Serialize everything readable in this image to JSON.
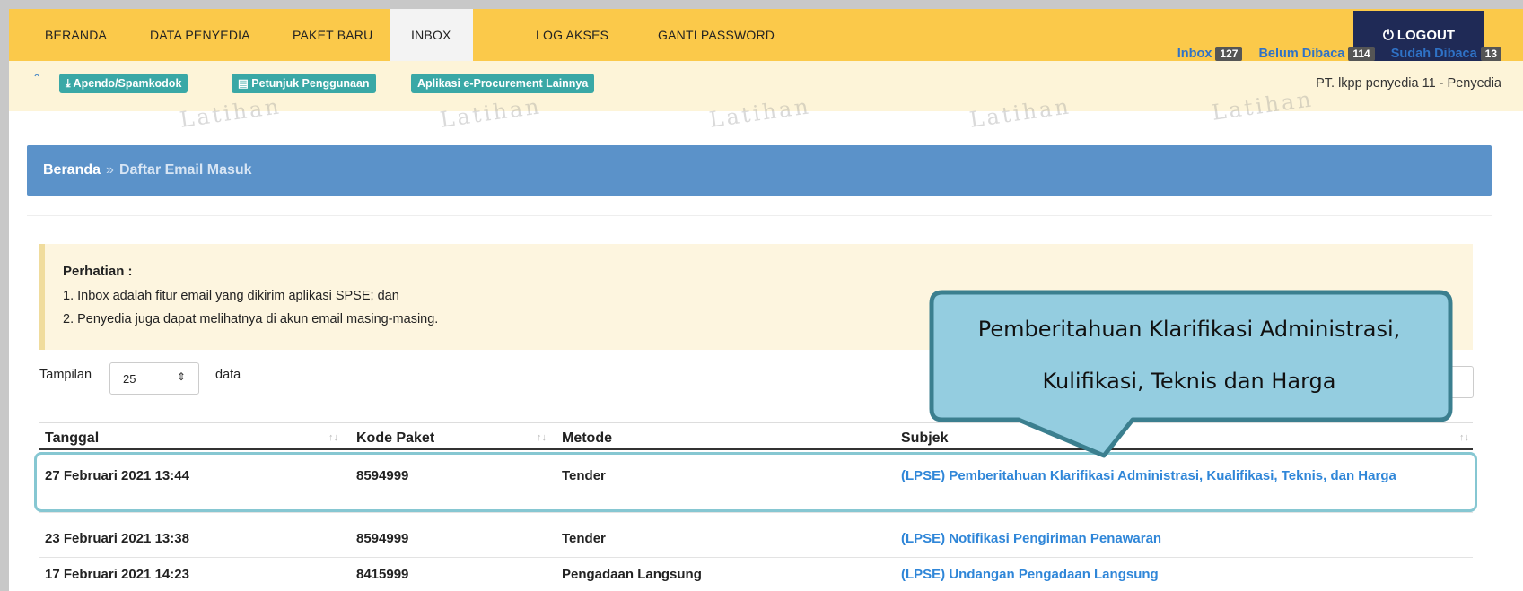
{
  "nav": {
    "items": [
      {
        "label": "BERANDA"
      },
      {
        "label": "DATA PENYEDIA"
      },
      {
        "label": "PAKET BARU"
      },
      {
        "label": "INBOX"
      },
      {
        "label": "LOG AKSES"
      },
      {
        "label": "GANTI PASSWORD"
      }
    ],
    "active": "INBOX",
    "logout_label": "LOGOUT",
    "logout_icon": "power-icon"
  },
  "subbar": {
    "links": [
      {
        "label": "Apendo/Spamkodok",
        "icon": "download-icon"
      },
      {
        "label": "Petunjuk Penggunaan",
        "icon": "book-icon"
      },
      {
        "label": "Aplikasi e-Procurement Lainnya"
      }
    ],
    "user": "PT. lkpp penyedia 11 - Penyedia"
  },
  "counters": {
    "inbox_label": "Inbox",
    "inbox_count": "127",
    "unread_label": "Belum Dibaca",
    "unread_count": "114",
    "read_label": "Sudah Dibaca",
    "read_count": "13"
  },
  "watermark": "Latihan",
  "breadcrumb": {
    "home": "Beranda",
    "separator": "»",
    "current": "Daftar Email Masuk"
  },
  "notice": {
    "title": "Perhatian :",
    "line1": "1. Inbox adalah fitur email yang dikirim aplikasi SPSE; dan",
    "line2": "2. Penyedia juga dapat melihatnya di akun email masing-masing."
  },
  "show": {
    "label": "Tampilan",
    "value": "25",
    "suffix": "data"
  },
  "table": {
    "headers": [
      "Tanggal",
      "Kode Paket",
      "Metode",
      "Subjek"
    ],
    "rows": [
      {
        "tanggal": "27 Februari 2021 13:44",
        "kode": "8594999",
        "metode": "Tender",
        "subjek": "(LPSE) Pemberitahuan Klarifikasi Administrasi, Kualifikasi, Teknis, dan Harga"
      },
      {
        "tanggal": "23 Februari 2021 13:38",
        "kode": "8594999",
        "metode": "Tender",
        "subjek": "(LPSE) Notifikasi Pengiriman Penawaran"
      },
      {
        "tanggal": "17 Februari 2021 14:23",
        "kode": "8415999",
        "metode": "Pengadaan Langsung",
        "subjek": "(LPSE) Undangan Pengadaan Langsung"
      }
    ]
  },
  "callout": {
    "line1": "Pemberitahuan Klarifikasi Administrasi,",
    "line2": "Kulifikasi, Teknis dan Harga"
  },
  "colors": {
    "nav_bg": "#fbc94a",
    "logout_bg": "#1f2a56",
    "pill_bg": "#3aa8a6",
    "breadcrumb_bg": "#5b92c9",
    "link": "#2f86d8",
    "callout_fill": "#94cde0",
    "callout_border": "#3b7f8f"
  }
}
